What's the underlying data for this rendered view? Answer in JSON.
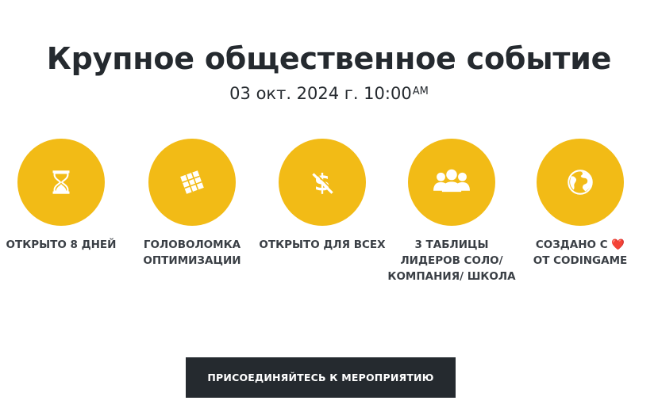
{
  "event": {
    "title": "Крупное общественное событие",
    "date": "03 окт. 2024 г. 10:00",
    "date_suffix": "AM"
  },
  "features": [
    {
      "icon": "hourglass-icon",
      "label": "ОТКРЫТО 8 ДНЕЙ"
    },
    {
      "icon": "rubiks-cube-icon",
      "label": "ГОЛОВОЛОМКА ОПТИМИЗАЦИИ"
    },
    {
      "icon": "no-dollar-icon",
      "label": "ОТКРЫТО ДЛЯ ВСЕХ"
    },
    {
      "icon": "team-icon",
      "label": "3 ТАБЛИЦЫ ЛИДЕРОВ СОЛО/ КОМПАНИЯ/ ШКОЛА"
    },
    {
      "icon": "globe-icon",
      "label_prefix": "СОЗДАНО С",
      "heart": "❤️",
      "label_suffix": "ОТ CODINGAME"
    }
  ],
  "cta": {
    "label": "ПРИСОЕДИНЯЙТЕСЬ К МЕРОПРИЯТИЮ"
  },
  "colors": {
    "accent": "#f2bb16",
    "dark": "#252a2f",
    "text": "#3a3f45",
    "heart": "#e02424"
  }
}
